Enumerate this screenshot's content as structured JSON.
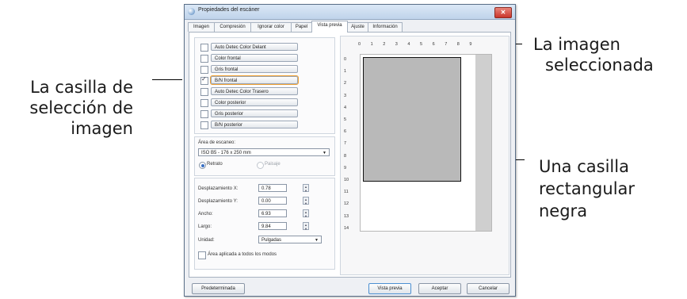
{
  "window": {
    "title": "Propiedades del escáner",
    "close_label": "✕"
  },
  "tabs": [
    {
      "label": "Imagen"
    },
    {
      "label": "Compresión"
    },
    {
      "label": "Ignorar color"
    },
    {
      "label": "Papel"
    },
    {
      "label": "Vista previa",
      "active": true
    },
    {
      "label": "Ajuste"
    },
    {
      "label": "Información"
    }
  ],
  "image_options": [
    {
      "label": "Auto Detec Color Delant",
      "checked": false
    },
    {
      "label": "Color frontal",
      "checked": false
    },
    {
      "label": "Gris frontal",
      "checked": false
    },
    {
      "label": "B/N frontal",
      "checked": true,
      "selected": true
    },
    {
      "label": "Auto Detec Color Trasero",
      "checked": false
    },
    {
      "label": "Color posterior",
      "checked": false
    },
    {
      "label": "Gris posterior",
      "checked": false
    },
    {
      "label": "B/N posterior",
      "checked": false
    }
  ],
  "scan_area": {
    "label": "Área de escaneo:",
    "value": "ISO B5 - 176 x 250 mm",
    "orientation_portrait": "Retrato",
    "orientation_landscape": "Paisaje",
    "portrait_selected": true
  },
  "fields": {
    "offset_x_label": "Desplazamiento X:",
    "offset_x_value": "0.78",
    "offset_y_label": "Desplazamiento Y:",
    "offset_y_value": "0.00",
    "width_label": "Ancho:",
    "width_value": "6.93",
    "length_label": "Largo:",
    "length_value": "9.84",
    "unit_label": "Unidad:",
    "unit_value": "Pulgadas",
    "apply_all_label": "Área aplicada a todos los modos"
  },
  "ruler": {
    "top": [
      "0",
      "1",
      "2",
      "3",
      "4",
      "5",
      "6",
      "7",
      "8",
      "9"
    ],
    "left": [
      "0",
      "1",
      "2",
      "3",
      "4",
      "5",
      "6",
      "7",
      "8",
      "9",
      "10",
      "11",
      "12",
      "13",
      "14"
    ]
  },
  "buttons": {
    "default": "Predeterminada",
    "preview": "Vista previa",
    "accept": "Aceptar",
    "cancel": "Cancelar"
  },
  "callouts": {
    "selected_image": "La imagen\nseleccionada",
    "checkbox": "La casilla de\nselección de\nimagen",
    "black_box": "Una casilla\nrectangular\nnegra"
  },
  "colors": {
    "selection_outline": "#f0a030",
    "close_button": "#c9342a",
    "radio_selected": "#3a6fc4"
  }
}
